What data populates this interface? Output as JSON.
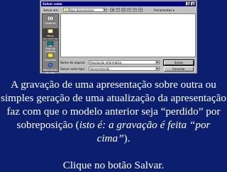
{
  "dialog": {
    "title": "Salvar como",
    "title_buttons": [
      "?",
      "×"
    ],
    "look_in_label": "Salvar em:",
    "look_in_value": "Meus documentos",
    "tools_label": "Ferramentas",
    "places": [
      {
        "label": "Histórico",
        "icon": "history-icon"
      },
      {
        "label": "Meus documentos",
        "icon": "my-documents-icon"
      },
      {
        "label": "Área de trabalho",
        "icon": "desktop-icon"
      },
      {
        "label": "Favoritos",
        "icon": "favorites-icon"
      },
      {
        "label": "Meus locais de rede",
        "icon": "network-places-icon"
      }
    ],
    "file_name_label": "Nome do arquivo:",
    "file_name_value": "Resolução Informática",
    "file_type_label": "Salvar como tipo:",
    "file_type_value": "Apresentação",
    "save_button": "Salvar",
    "cancel_button": "Cancelar"
  },
  "caption": {
    "part1": "A gravação de uma apresentação sobre outra ou simples geração de uma atualização da apresentação faz com que o modelo anterior seja “perdido” por sobreposição (",
    "italic": "isto é: a gravação é feita “por cima”",
    "part2": ").",
    "cta": "Clique no botão Salvar."
  },
  "colors": {
    "background": "#0b1f6e",
    "text": "#ffffff",
    "titlebar": "#000080",
    "dialog": "#c0c0c0"
  }
}
